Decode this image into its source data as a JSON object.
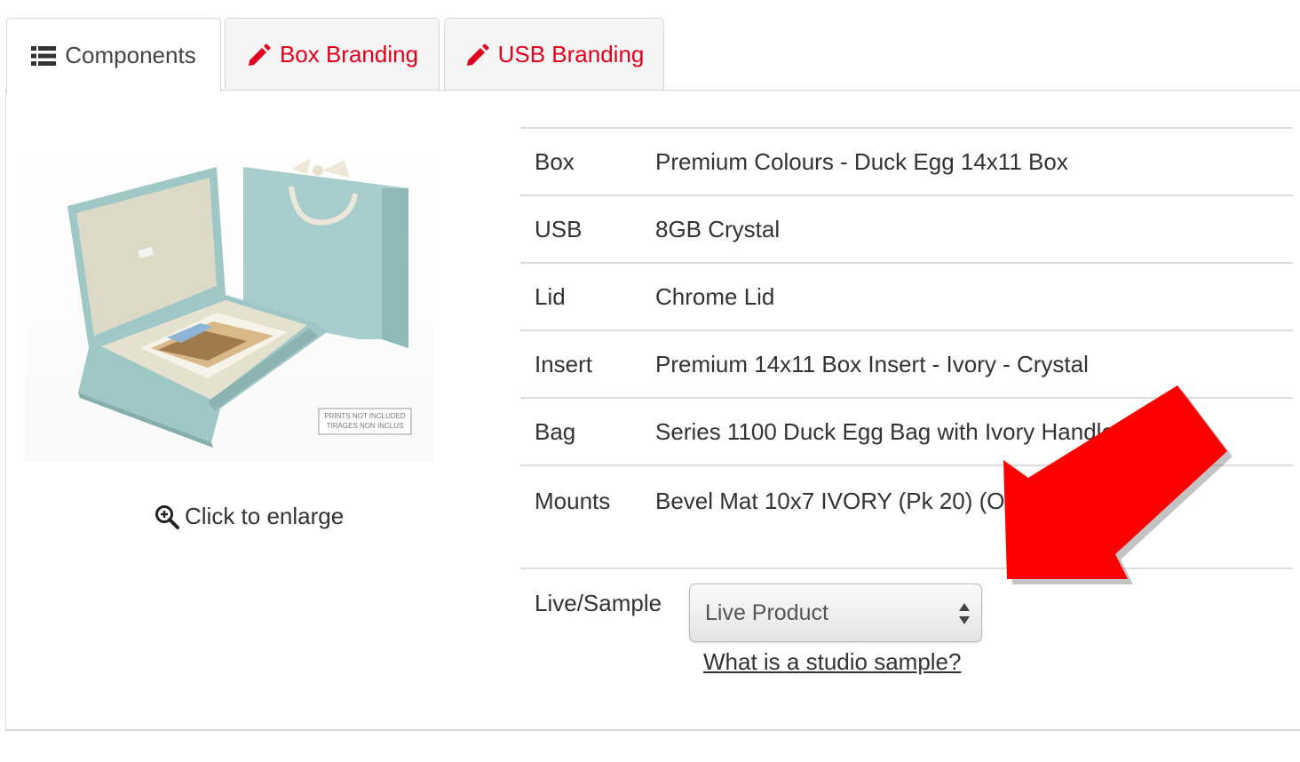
{
  "tabs": [
    {
      "label": "Components",
      "icon": "list-icon",
      "active": true,
      "color": "#444444"
    },
    {
      "label": "Box Branding",
      "icon": "pencil-icon",
      "active": false,
      "color": "#e4001b"
    },
    {
      "label": "USB Branding",
      "icon": "pencil-icon",
      "active": false,
      "color": "#e4001b"
    }
  ],
  "image": {
    "enlarge_label": "Click to enlarge",
    "print_notice": [
      "PRINTS NOT INCLUDED",
      "TIRAGES NON INCLUS"
    ]
  },
  "specs": [
    {
      "label": "Box",
      "value": "Premium Colours - Duck Egg 14x11 Box"
    },
    {
      "label": "USB",
      "value": "8GB Crystal"
    },
    {
      "label": "Lid",
      "value": "Chrome Lid"
    },
    {
      "label": "Insert",
      "value": "Premium 14x11 Box Insert - Ivory - Crystal"
    },
    {
      "label": "Bag",
      "value": "Series 1100 Duck Egg Bag with Ivory Handles"
    },
    {
      "label": "Mounts",
      "value": "Bevel Mat 10x7 IVORY (Pk 20) (OS"
    }
  ],
  "live_sample": {
    "label": "Live/Sample",
    "selected": "Live Product",
    "link": "What is a studio sample?"
  },
  "colors": {
    "accent_red": "#e4001b",
    "duck_egg": "#9fc7c6",
    "arrow_red": "#ff0000"
  }
}
